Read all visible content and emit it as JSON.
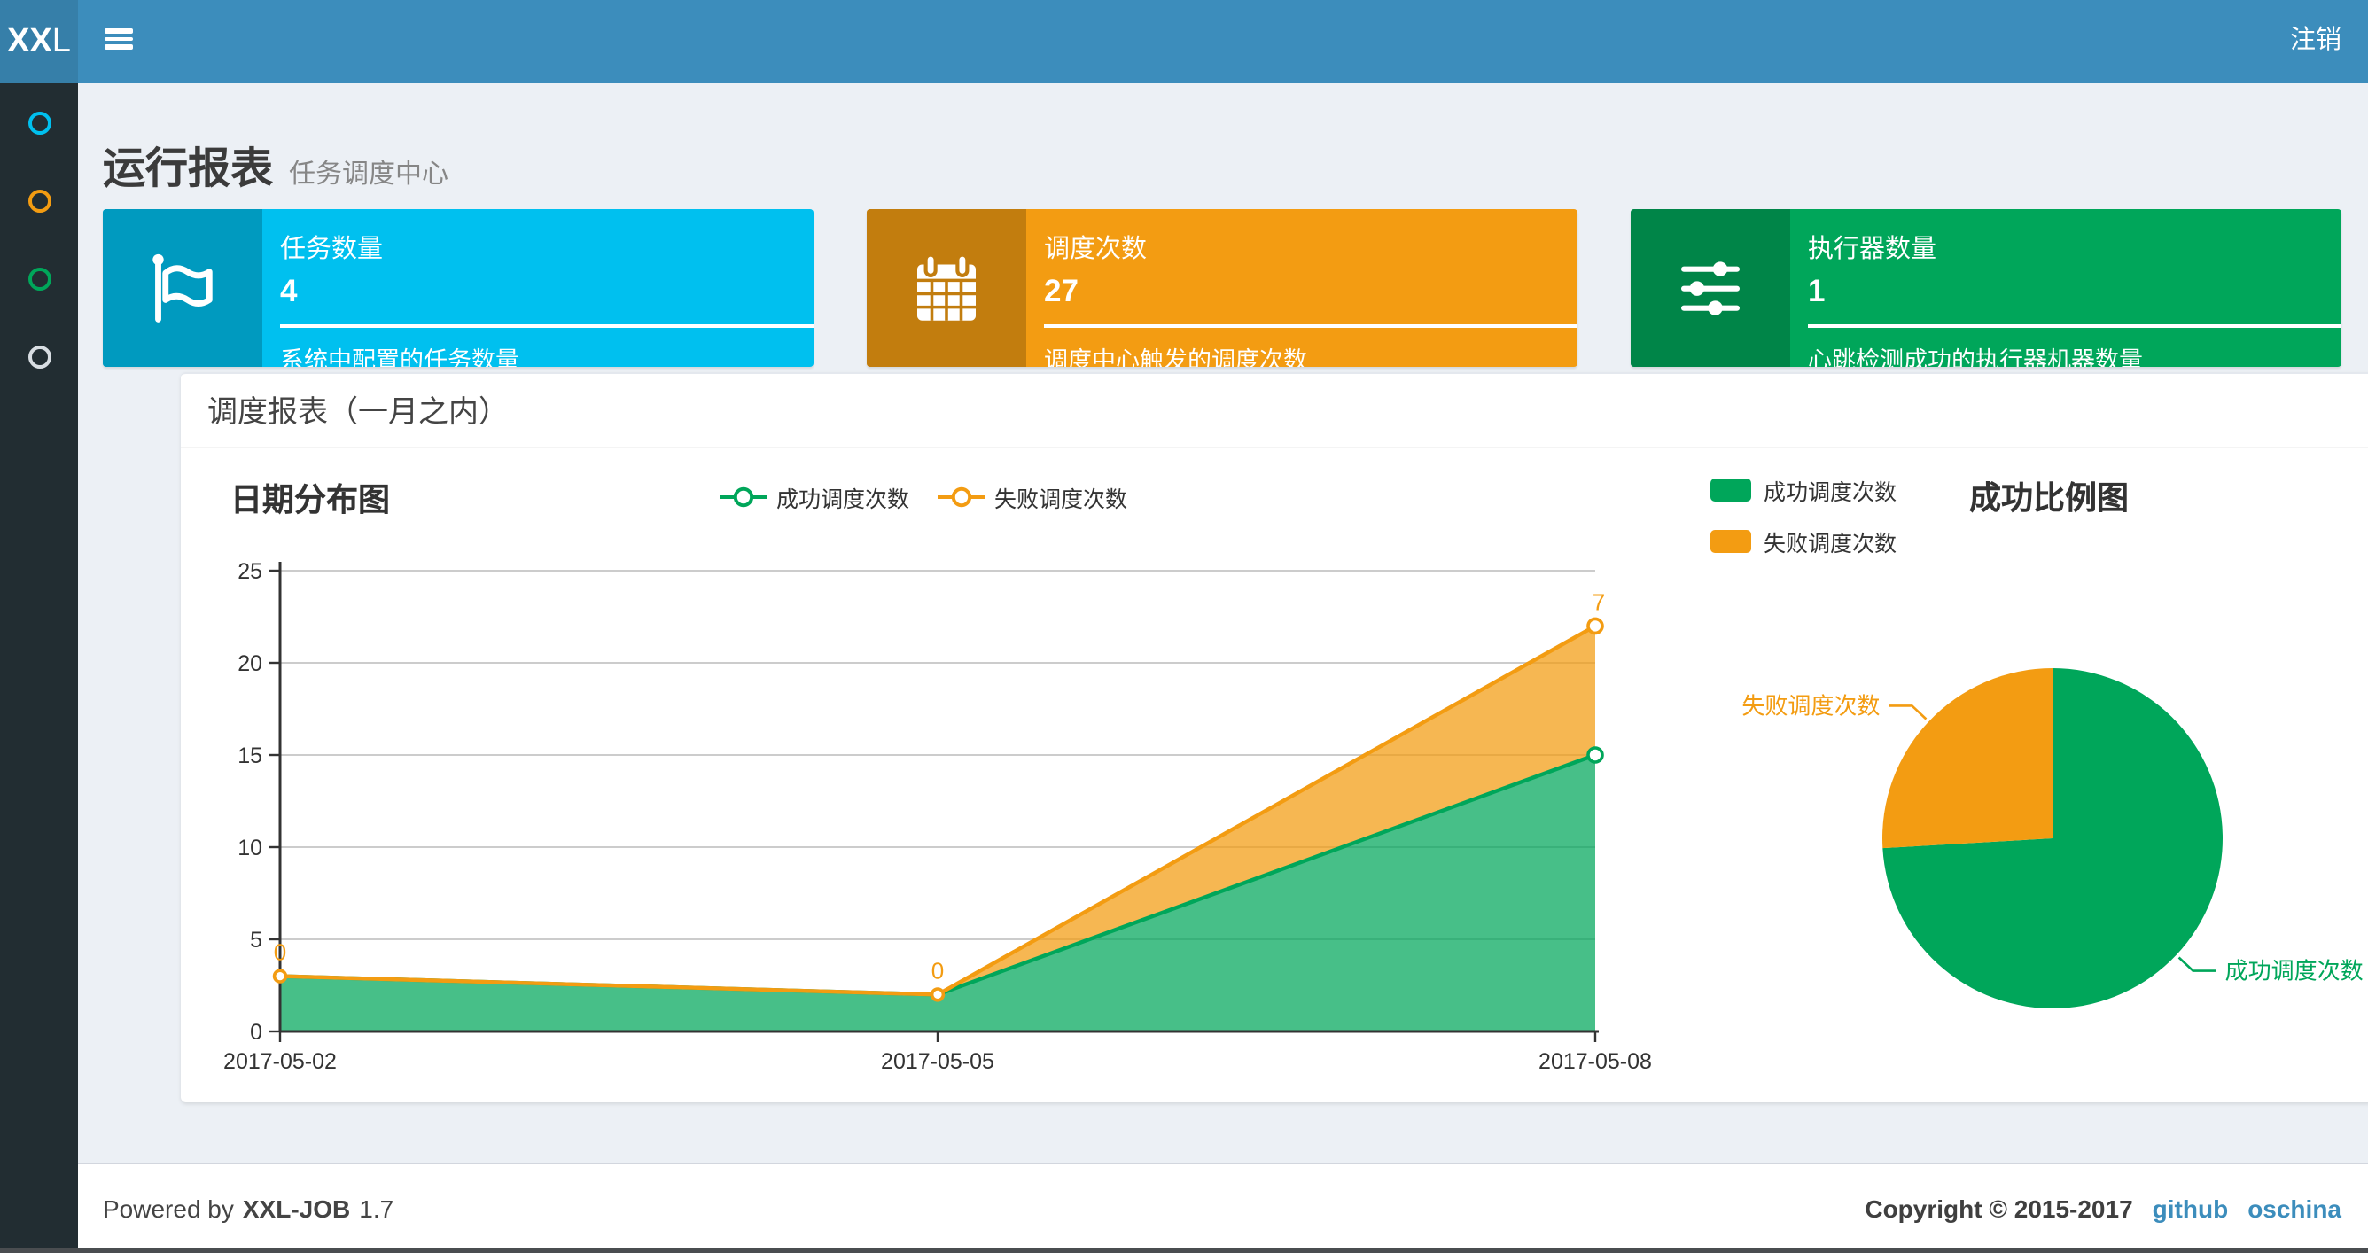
{
  "navbar": {
    "logo_bold": "XX",
    "logo_light": "L",
    "logout_label": "注销",
    "bg_color": "#3c8dbc",
    "logo_bg_color": "#367fa9"
  },
  "sidebar": {
    "bg_color": "#222d32",
    "items": [
      {
        "icon": "circle-icon",
        "color": "#00c0ef"
      },
      {
        "icon": "circle-icon",
        "color": "#f39c12"
      },
      {
        "icon": "circle-icon",
        "color": "#00a65a"
      },
      {
        "icon": "circle-icon",
        "color": "#d8dde2"
      }
    ]
  },
  "page_header": {
    "title": "运行报表",
    "subtitle": "任务调度中心"
  },
  "info_boxes": [
    {
      "icon": "flag-icon",
      "label": "任务数量",
      "value": "4",
      "description": "系统中配置的任务数量",
      "color": "#00c0ef",
      "icon_bg": "#009abf"
    },
    {
      "icon": "calendar-icon",
      "label": "调度次数",
      "value": "27",
      "description": "调度中心触发的调度次数",
      "color": "#f39c12",
      "icon_bg": "#c27d0e"
    },
    {
      "icon": "sliders-icon",
      "label": "执行器数量",
      "value": "1",
      "description": "心跳检测成功的执行器机器数量",
      "color": "#00a65a",
      "icon_bg": "#008548"
    }
  ],
  "panel": {
    "title": "调度报表（一月之内）"
  },
  "chart_data": [
    {
      "type": "area",
      "title": "日期分布图",
      "stacked": true,
      "x": [
        "2017-05-02",
        "2017-05-05",
        "2017-05-08"
      ],
      "series": [
        {
          "name": "成功调度次数",
          "color": "#00a65a",
          "values": [
            3,
            2,
            15
          ]
        },
        {
          "name": "失败调度次数",
          "color": "#f39c12",
          "values": [
            0,
            0,
            7
          ],
          "point_labels": [
            "0",
            "0",
            "7"
          ]
        }
      ],
      "ylim": [
        0,
        25
      ],
      "ytick_step": 5,
      "grid": true,
      "legend_position": "top-center"
    },
    {
      "type": "pie",
      "title": "成功比例图",
      "slices": [
        {
          "name": "成功调度次数",
          "value": 20,
          "color": "#00a65a"
        },
        {
          "name": "失败调度次数",
          "value": 7,
          "color": "#f39c12"
        }
      ],
      "start_angle_deg": 0,
      "legend_position": "top-left"
    }
  ],
  "footer": {
    "powered_by_prefix": "Powered by",
    "product_name": "XXL-JOB",
    "version": "1.7",
    "copyright": "Copyright © 2015-2017",
    "links": [
      {
        "label": "github"
      },
      {
        "label": "oschina"
      }
    ],
    "link_color": "#3c8dbc"
  }
}
